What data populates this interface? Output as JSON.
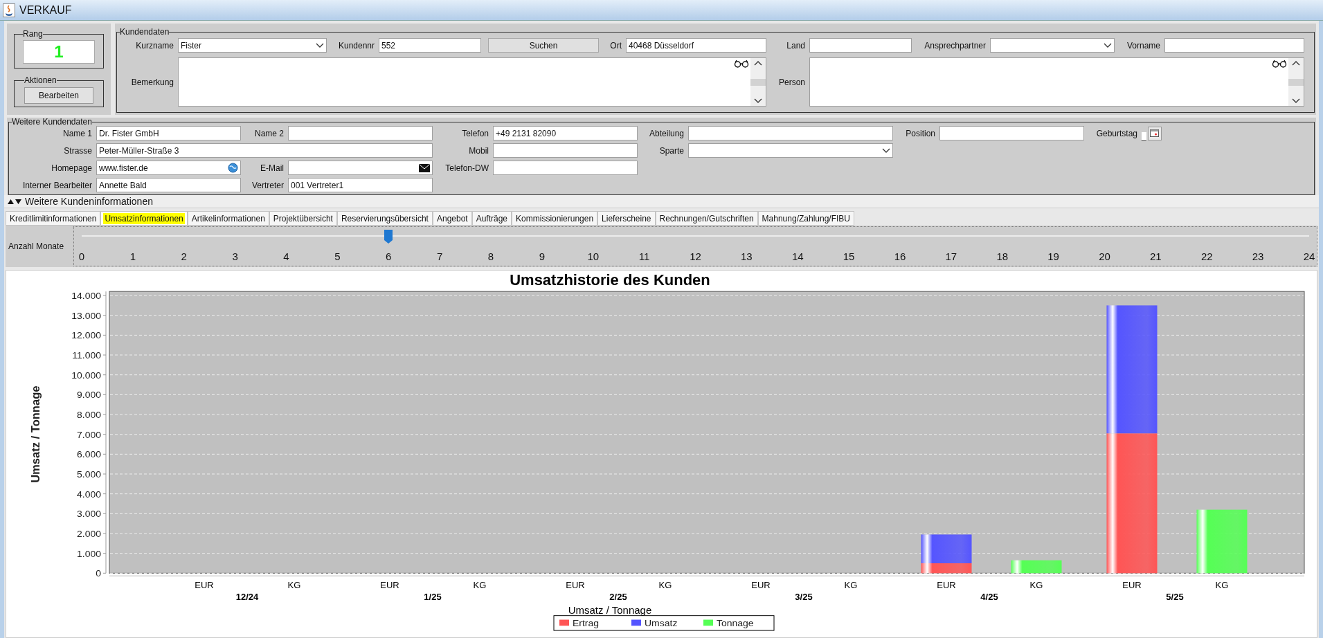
{
  "window": {
    "title": "VERKAUF"
  },
  "rang": {
    "title": "Rang",
    "value": "1"
  },
  "aktionen": {
    "title": "Aktionen",
    "buttons": [
      "Bearbeiten"
    ]
  },
  "kundendaten": {
    "title": "Kundendaten",
    "fields": [
      {
        "kind": "combo",
        "label": "Kurzname",
        "value": "Fister"
      },
      {
        "kind": "text",
        "label": "Kundennr",
        "value": "552"
      },
      {
        "kind": "button",
        "label": "Suchen"
      },
      {
        "kind": "text",
        "label": "Ort",
        "value": "40468 Düsseldorf"
      },
      {
        "kind": "text",
        "label": "Land"
      },
      {
        "kind": "combo",
        "label": "Ansprechpartner"
      },
      {
        "kind": "text",
        "label": "Vorname"
      }
    ],
    "notes": [
      {
        "label": "Bemerkung"
      },
      {
        "label": "Person"
      }
    ]
  },
  "weitere_kundendaten": {
    "title": "Weitere Kundendaten",
    "rows": [
      [
        {
          "kind": "text",
          "label": "Name 1",
          "value": "Dr. Fister GmbH"
        },
        {
          "kind": "text",
          "label": "Name 2"
        },
        {
          "kind": "text",
          "label": "Telefon",
          "value": "+49 2131 82090"
        },
        {
          "kind": "text",
          "label": "Abteilung"
        },
        {
          "kind": "text",
          "label": "Position"
        },
        {
          "kind": "date",
          "label": "Geburtstag",
          "value": "_"
        }
      ],
      [
        {
          "kind": "text",
          "label": "Strasse",
          "value": "Peter-Müller-Straße 3"
        },
        null,
        {
          "kind": "text",
          "label": "Mobil"
        },
        {
          "kind": "combo",
          "label": "Sparte"
        }
      ],
      [
        {
          "kind": "url",
          "label": "Homepage",
          "value": "www.fister.de"
        },
        {
          "kind": "email",
          "label": "E-Mail"
        },
        {
          "kind": "text",
          "label": "Telefon-DW"
        }
      ],
      [
        {
          "kind": "text",
          "label": "Interner Bearbeiter",
          "value": "Annette Bald"
        },
        {
          "kind": "text",
          "label": "Vertreter",
          "value": "001 Vertreter1"
        }
      ]
    ]
  },
  "weitere_kundeninformationen": {
    "label": "Weitere Kundeninformationen",
    "expanded": true
  },
  "tabs": [
    {
      "label": "Kreditlimitinformationen",
      "selected": false
    },
    {
      "label": "Umsatzinformationen",
      "selected": true
    },
    {
      "label": "Artikelinformationen",
      "selected": false
    },
    {
      "label": "Projektübersicht",
      "selected": false
    },
    {
      "label": "Reservierungsübersicht",
      "selected": false
    },
    {
      "label": "Angebot",
      "selected": false
    },
    {
      "label": "Aufträge",
      "selected": false
    },
    {
      "label": "Kommissionierungen",
      "selected": false
    },
    {
      "label": "Lieferscheine",
      "selected": false
    },
    {
      "label": "Rechnungen/Gutschriften",
      "selected": false
    },
    {
      "label": "Mahnung/Zahlung/FIBU",
      "selected": false
    }
  ],
  "slider": {
    "label": "Anzahl Monate",
    "level": 0.25,
    "ticks": [
      "0",
      "1",
      "2",
      "3",
      "4",
      "5",
      "6",
      "7",
      "8",
      "9",
      "10",
      "11",
      "12",
      "13",
      "14",
      "15",
      "16",
      "17",
      "18",
      "19",
      "20",
      "21",
      "22",
      "23",
      "24"
    ]
  },
  "chart": {
    "chart_data": {
      "type": "bar",
      "stacked": true,
      "title": "Umsatzhistorie des Kunden",
      "xlabel": "Umsatz / Tonnage",
      "ylabel": "Umsatz / Tonnage",
      "annotations": [
        "12/24",
        "1/25",
        "2/25",
        "3/25",
        "4/25",
        "5/25"
      ],
      "grid": true,
      "legend": true,
      "categories": [
        "EUR",
        "KG",
        "EUR",
        "KG",
        "EUR",
        "KG",
        "EUR",
        "KG",
        "EUR",
        "KG",
        "EUR",
        "KG"
      ],
      "series": [
        {
          "name": "Ertrag",
          "color": "#ff5555",
          "values": [
            0,
            null,
            0,
            null,
            0,
            null,
            0,
            null,
            500,
            null,
            7050,
            null
          ]
        },
        {
          "name": "Umsatz",
          "color": "#5555ff",
          "values": [
            0,
            null,
            0,
            null,
            0,
            null,
            0,
            null,
            1450,
            null,
            6450,
            null
          ]
        },
        {
          "name": "Tonnage",
          "color": "#55ff55",
          "values": [
            null,
            0,
            null,
            0,
            null,
            0,
            null,
            0,
            null,
            650,
            null,
            3200
          ]
        }
      ],
      "ylim": [
        0,
        14000
      ],
      "yticks": [
        {
          "value": 0,
          "label": "0"
        },
        {
          "value": 1000,
          "label": "1.000"
        },
        {
          "value": 2000,
          "label": "2.000"
        },
        {
          "value": 3000,
          "label": "3.000"
        },
        {
          "value": 4000,
          "label": "4.000"
        },
        {
          "value": 5000,
          "label": "5.000"
        },
        {
          "value": 6000,
          "label": "6.000"
        },
        {
          "value": 7000,
          "label": "7.000"
        },
        {
          "value": 8000,
          "label": "8.000"
        },
        {
          "value": 9000,
          "label": "9.000"
        },
        {
          "value": 10000,
          "label": "10.000"
        },
        {
          "value": 11000,
          "label": "11.000"
        },
        {
          "value": 12000,
          "label": "12.000"
        },
        {
          "value": 13000,
          "label": "13.000"
        },
        {
          "value": 14000,
          "label": "14.000"
        }
      ]
    }
  }
}
